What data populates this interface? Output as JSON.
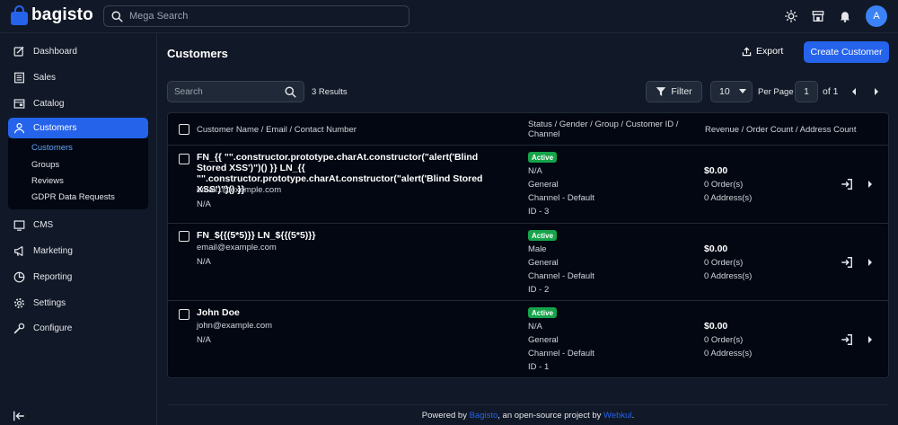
{
  "app": {
    "brand": "bagisto"
  },
  "topbar": {
    "search_placeholder": "Mega Search",
    "avatar_letter": "A",
    "icons": [
      "sun-icon",
      "store-icon",
      "bell-icon"
    ]
  },
  "sidebar": {
    "items": [
      {
        "label": "Dashboard",
        "icon": "dashboard-icon"
      },
      {
        "label": "Sales",
        "icon": "sales-icon"
      },
      {
        "label": "Catalog",
        "icon": "catalog-icon"
      },
      {
        "label": "Customers",
        "icon": "customers-icon",
        "active": true
      },
      {
        "label": "CMS",
        "icon": "cms-icon"
      },
      {
        "label": "Marketing",
        "icon": "marketing-icon"
      },
      {
        "label": "Reporting",
        "icon": "reporting-icon"
      },
      {
        "label": "Settings",
        "icon": "settings-icon"
      },
      {
        "label": "Configure",
        "icon": "configure-icon"
      }
    ],
    "subitems": [
      {
        "label": "Customers",
        "active": true
      },
      {
        "label": "Groups"
      },
      {
        "label": "Reviews"
      },
      {
        "label": "GDPR Data Requests"
      }
    ]
  },
  "page": {
    "title": "Customers",
    "export_label": "Export",
    "create_label": "Create Customer"
  },
  "toolbar": {
    "search_placeholder": "Search",
    "results": "3 Results",
    "filter_label": "Filter",
    "per_page_value": "10",
    "per_page_label": "Per Page",
    "page_value": "1",
    "page_of": "of 1"
  },
  "table": {
    "headers": {
      "name": "Customer Name / Email / Contact Number",
      "status": "Status / Gender / Group / Customer ID / Channel",
      "revenue": "Revenue / Order Count / Address Count"
    },
    "rows": [
      {
        "name": "FN_{{ \"\".constructor.prototype.charAt.constructor(\"alert('Blind Stored XSS')\")() }} LN_{{ \"\".constructor.prototype.charAt.constructor(\"alert('Blind Stored XSS')\")() }}",
        "email": "email1@example.com",
        "phone": "N/A",
        "status": "Active",
        "gender": "N/A",
        "group": "General",
        "channel": "Channel - Default",
        "id": "ID - 3",
        "revenue": "$0.00",
        "orders": "0 Order(s)",
        "addresses": "0 Address(s)"
      },
      {
        "name": "FN_${{(5*5)}} LN_${{(5*5)}}",
        "email": "email@example.com",
        "phone": "N/A",
        "status": "Active",
        "gender": "Male",
        "group": "General",
        "channel": "Channel - Default",
        "id": "ID - 2",
        "revenue": "$0.00",
        "orders": "0 Order(s)",
        "addresses": "0 Address(s)"
      },
      {
        "name": "John Doe",
        "email": "john@example.com",
        "phone": "N/A",
        "status": "Active",
        "gender": "N/A",
        "group": "General",
        "channel": "Channel - Default",
        "id": "ID - 1",
        "revenue": "$0.00",
        "orders": "0 Order(s)",
        "addresses": "0 Address(s)"
      }
    ]
  },
  "footer": {
    "prefix": "Powered by ",
    "link1": "Bagisto",
    "middle": ", an open-source project by ",
    "link2": "Webkul",
    "suffix": "."
  },
  "colors": {
    "accent": "#2563eb",
    "active_badge": "#16a34a",
    "background": "#111827",
    "panel": "#030712"
  }
}
